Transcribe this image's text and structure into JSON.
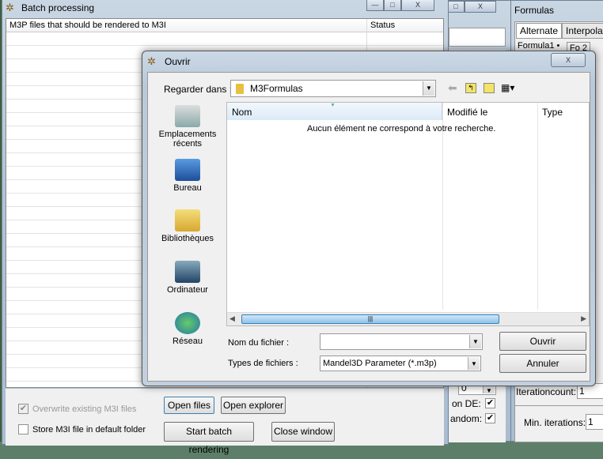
{
  "batch": {
    "title": "Batch processing",
    "col_files": "M3P files that should be rendered to M3I",
    "col_status": "Status",
    "overwrite_label": "Overwrite existing M3I files",
    "overwrite_checked": true,
    "overwrite_disabled": true,
    "store_label": "Store M3I file in default folder",
    "store_checked": false,
    "open_files": "Open files",
    "open_explorer": "Open explorer",
    "start": "Start batch rendering",
    "close": "Close window"
  },
  "bg_window": {
    "de_label": "on DE:",
    "random_label": "andom:",
    "combo_value": "0"
  },
  "formulas": {
    "title": "Formulas",
    "tabs": [
      "Alternate",
      "Interpolate"
    ],
    "subtabs": [
      "Formula1 •",
      "Fo 2"
    ],
    "iterationcount_label": "Iterationcount:",
    "iterationcount_value": "1",
    "min_iter_label": "Min. iterations:",
    "min_iter_value": "1"
  },
  "dialog": {
    "title": "Ouvrir",
    "look_in_label": "Regarder dans :",
    "look_in_value": "M3Formulas",
    "places": [
      "Emplacements récents",
      "Bureau",
      "Bibliothèques",
      "Ordinateur",
      "Réseau"
    ],
    "columns": [
      "Nom",
      "Modifié le",
      "Type"
    ],
    "empty_message": "Aucun élément ne correspond à votre recherche.",
    "filename_label": "Nom du fichier :",
    "filename_value": "",
    "filetype_label": "Types de fichiers :",
    "filetype_value": "Mandel3D Parameter (*.m3p)",
    "open": "Ouvrir",
    "cancel": "Annuler"
  }
}
